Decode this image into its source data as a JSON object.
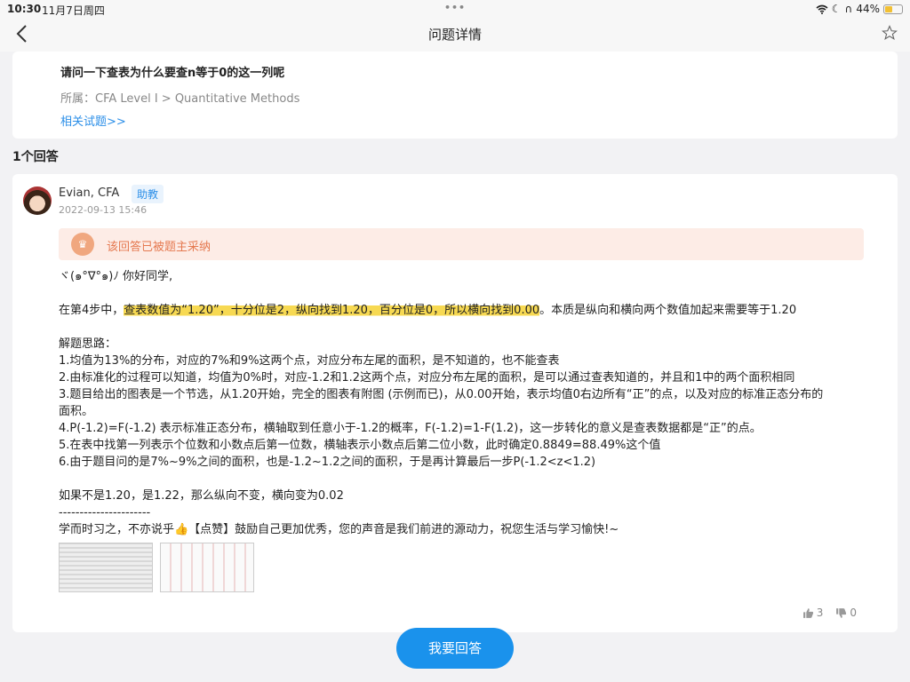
{
  "status_bar": {
    "time": "10:30",
    "date": "11月7日周四",
    "dots": "•••",
    "battery": "44%",
    "battery_level": 0.44
  },
  "nav": {
    "title": "问题详情"
  },
  "question": {
    "text": "请问一下查表为什么要查n等于0的这一列呢",
    "path": "所属：CFA Level I > Quantitative Methods",
    "related_link": "相关试题>>"
  },
  "answers_count": "1个回答",
  "answer": {
    "author": "Evian, CFA",
    "role": "助教",
    "time": "2022-09-13 15:46",
    "adopted": "该回答已被题主采纳",
    "greeting": "ヾ(๑°∇°๑)ﾉ 你好同学,",
    "p1_pre": "在第4步中，",
    "p1_highlight": "查表数值为“1.20”，十分位是2，纵向找到1.20，百分位是0，所以横向找到0.00",
    "p1_post": "。本质是纵向和横向两个数值加起来需要等于1.20",
    "steps_title": "解题思路：",
    "step1": "1.均值为13%的分布，对应的7%和9%这两个点，对应分布左尾的面积，是不知道的，也不能查表",
    "step2": "2.由标准化的过程可以知道，均值为0%时，对应-1.2和1.2这两个点，对应分布左尾的面积，是可以通过查表知道的，并且和1中的两个面积相同",
    "step3a": "3.题目给出的图表是一个节选，从1.20开始，完全的图表有附图 (示例而已)，从0.00开始，表示均值0右边所有“正”的点，以及对应的标准正态分布的",
    "step3b": "面积。",
    "step4": "4.P(-1.2)=F(-1.2) 表示标准正态分布，横轴取到任意小于-1.2的概率，F(-1.2)=1-F(1.2)，这一步转化的意义是查表数据都是“正”的点。",
    "step5": "5.在表中找第一列表示个位数和小数点后第一位数，横轴表示小数点后第二位小数，此时确定0.8849=88.49%这个值",
    "step6": "6.由于题目问的是7%~9%之间的面积，也是-1.2~1.2之间的面积，于是再计算最后一步P(-1.2<z<1.2)",
    "extra": "如果不是1.20，是1.22，那么纵向不变，横向变为0.02",
    "divider": "----------------------",
    "closing": "学而时习之，不亦说乎👍【点赞】鼓励自己更加优秀，您的声音是我们前进的源动力，祝您生活与学习愉快!~",
    "likes": "3",
    "dislikes": "0"
  },
  "answer_button": "我要回答"
}
